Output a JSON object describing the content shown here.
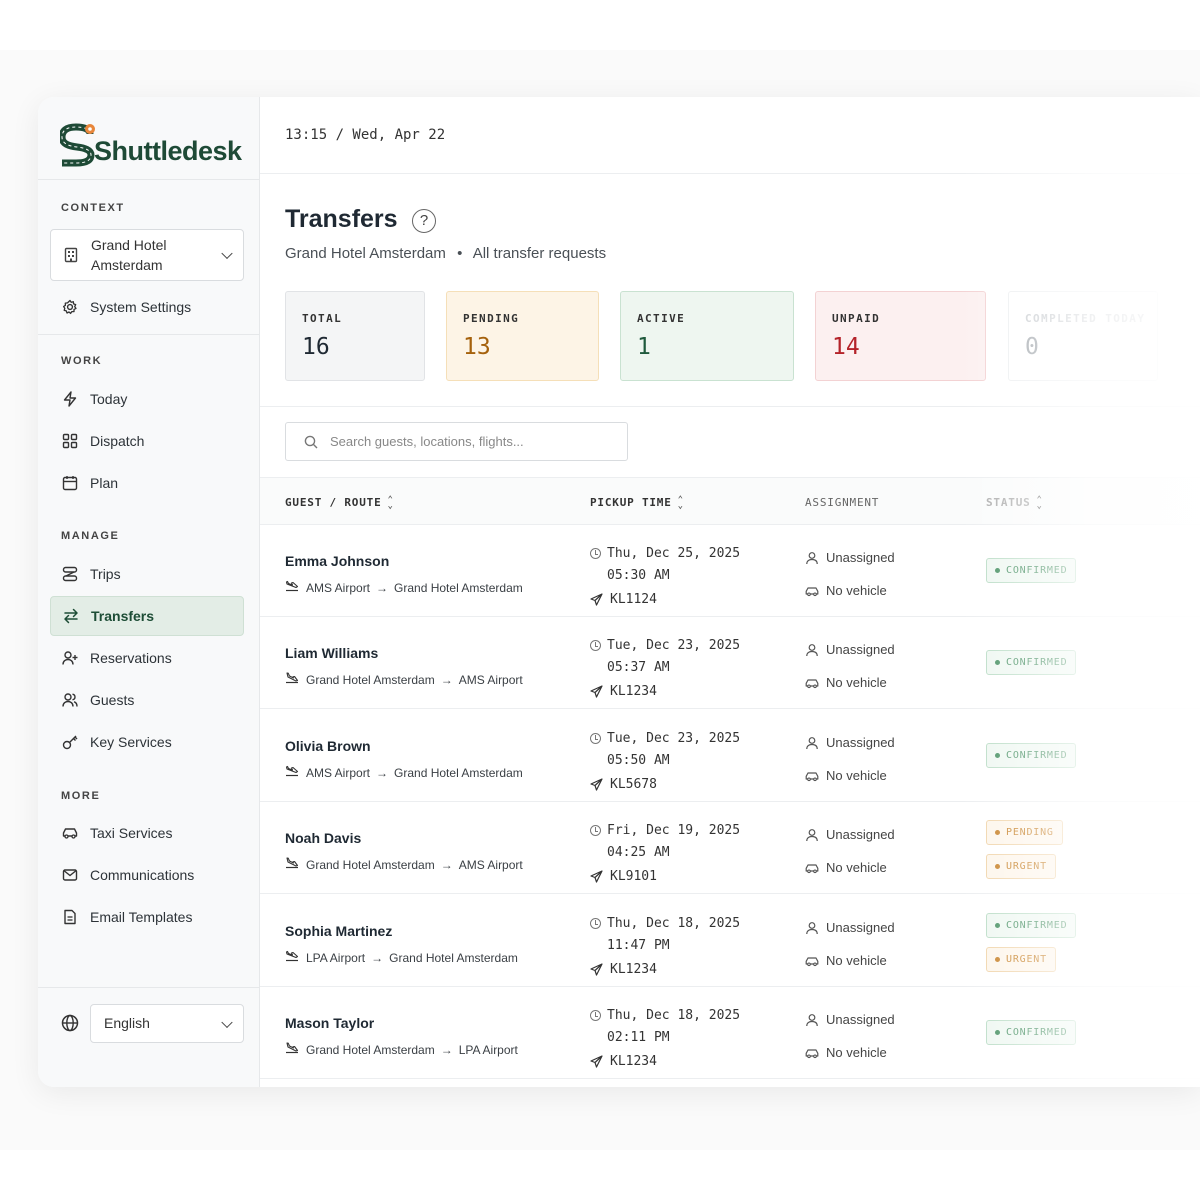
{
  "app": {
    "name": "Shuttledesk"
  },
  "sidebar": {
    "context_heading": "CONTEXT",
    "context_value": "Grand Hotel Amsterdam",
    "system_settings": "System Settings",
    "work_heading": "WORK",
    "work_items": [
      {
        "label": "Today",
        "icon": "bolt-icon"
      },
      {
        "label": "Dispatch",
        "icon": "grid-icon"
      },
      {
        "label": "Plan",
        "icon": "calendar-icon"
      }
    ],
    "manage_heading": "MANAGE",
    "manage_items": [
      {
        "label": "Trips",
        "icon": "route-icon"
      },
      {
        "label": "Transfers",
        "icon": "swap-icon",
        "active": true
      },
      {
        "label": "Reservations",
        "icon": "user-plus-icon"
      },
      {
        "label": "Guests",
        "icon": "users-icon"
      },
      {
        "label": "Key Services",
        "icon": "key-icon"
      }
    ],
    "more_heading": "MORE",
    "more_items": [
      {
        "label": "Taxi Services",
        "icon": "car-icon"
      },
      {
        "label": "Communications",
        "icon": "mail-icon"
      },
      {
        "label": "Email Templates",
        "icon": "file-icon"
      }
    ],
    "language": "English"
  },
  "topbar": {
    "clock": "13:15 / Wed, Apr 22"
  },
  "page": {
    "title": "Transfers",
    "help": "?",
    "subtitle_context": "Grand Hotel Amsterdam",
    "subtitle_separator": "•",
    "subtitle_scope": "All transfer requests"
  },
  "stats": [
    {
      "label": "TOTAL",
      "value": "16",
      "color": "#1f2933",
      "bg": "#f4f5f6",
      "border": "#e1e3e6"
    },
    {
      "label": "PENDING",
      "value": "13",
      "color": "#a5610c",
      "bg": "#fdf4e6",
      "border": "#f5dfb8"
    },
    {
      "label": "ACTIVE",
      "value": "1",
      "color": "#1f5a3d",
      "bg": "#eef6f0",
      "border": "#c9e2d1"
    },
    {
      "label": "UNPAID",
      "value": "14",
      "color": "#b4232a",
      "bg": "#fcf0f0",
      "border": "#f3d2d3"
    },
    {
      "label": "COMPLETED TODAY",
      "value": "0",
      "color": "#9aa0a6",
      "bg": "#ffffff",
      "border": "#eceef0"
    }
  ],
  "search": {
    "placeholder": "Search guests, locations, flights..."
  },
  "table": {
    "headers": {
      "guest": "GUEST / ROUTE",
      "pickup": "PICKUP TIME",
      "assignment": "ASSIGNMENT",
      "status": "STATUS"
    },
    "rows": [
      {
        "guest": "Emma Johnson",
        "from": "AMS Airport",
        "to": "Grand Hotel Amsterdam",
        "date": "Thu, Dec 25, 2025",
        "time": "05:30 AM",
        "flight": "KL1124",
        "driver": "Unassigned",
        "vehicle": "No vehicle",
        "badges": [
          {
            "text": "CONFIRMED",
            "kind": "confirmed"
          }
        ]
      },
      {
        "guest": "Liam Williams",
        "from": "Grand Hotel Amsterdam",
        "to": "AMS Airport",
        "date": "Tue, Dec 23, 2025",
        "time": "05:37 AM",
        "flight": "KL1234",
        "driver": "Unassigned",
        "vehicle": "No vehicle",
        "badges": [
          {
            "text": "CONFIRMED",
            "kind": "confirmed"
          }
        ]
      },
      {
        "guest": "Olivia Brown",
        "from": "AMS Airport",
        "to": "Grand Hotel Amsterdam",
        "date": "Tue, Dec 23, 2025",
        "time": "05:50 AM",
        "flight": "KL5678",
        "driver": "Unassigned",
        "vehicle": "No vehicle",
        "badges": [
          {
            "text": "CONFIRMED",
            "kind": "confirmed"
          }
        ]
      },
      {
        "guest": "Noah Davis",
        "from": "Grand Hotel Amsterdam",
        "to": "AMS Airport",
        "date": "Fri, Dec 19, 2025",
        "time": "04:25 AM",
        "flight": "KL9101",
        "driver": "Unassigned",
        "vehicle": "No vehicle",
        "badges": [
          {
            "text": "PENDING",
            "kind": "pending"
          },
          {
            "text": "URGENT",
            "kind": "urgent"
          }
        ]
      },
      {
        "guest": "Sophia Martinez",
        "from": "LPA Airport",
        "to": "Grand Hotel Amsterdam",
        "date": "Thu, Dec 18, 2025",
        "time": "11:47 PM",
        "flight": "KL1234",
        "driver": "Unassigned",
        "vehicle": "No vehicle",
        "badges": [
          {
            "text": "CONFIRMED",
            "kind": "confirmed"
          },
          {
            "text": "URGENT",
            "kind": "urgent"
          }
        ]
      },
      {
        "guest": "Mason Taylor",
        "from": "Grand Hotel Amsterdam",
        "to": "LPA Airport",
        "date": "Thu, Dec 18, 2025",
        "time": "02:11 PM",
        "flight": "KL1234",
        "driver": "Unassigned",
        "vehicle": "No vehicle",
        "badges": [
          {
            "text": "CONFIRMED",
            "kind": "confirmed"
          }
        ]
      }
    ]
  },
  "colors": {
    "brand": "#1e4a36",
    "accent": "#e8863a",
    "confirmed": "#3d8a5a",
    "pending": "#c47a1c",
    "urgent": "#c47a1c"
  }
}
